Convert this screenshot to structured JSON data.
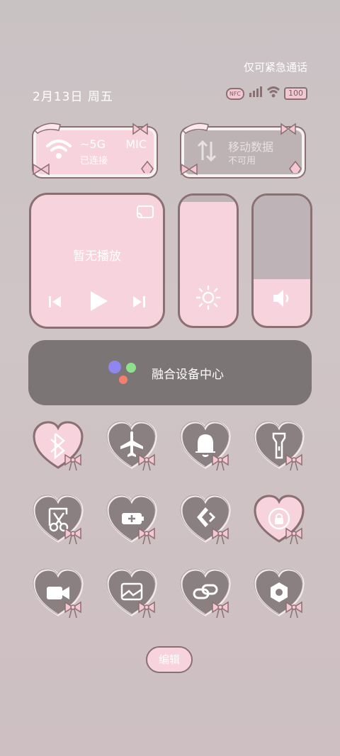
{
  "status": {
    "emergency_text": "仅可紧急通话",
    "date_text": "2月13日 周五",
    "battery": "100",
    "nfc": "NFC"
  },
  "tiles": {
    "wifi": {
      "title": "~5G",
      "subtitle": "已连接",
      "trailing": "MIC",
      "active": true
    },
    "mobile": {
      "title": "移动数据",
      "subtitle": "不可用",
      "active": false
    }
  },
  "media": {
    "label": "暂无播放"
  },
  "brightness": {
    "level": 0.95
  },
  "volume": {
    "level": 0.36
  },
  "fusion": {
    "label": "融合设备中心"
  },
  "toggles": [
    {
      "name": "bluetooth",
      "active": true
    },
    {
      "name": "airplane",
      "active": false
    },
    {
      "name": "bell",
      "active": false
    },
    {
      "name": "flashlight",
      "active": false
    },
    {
      "name": "screenshot",
      "active": false
    },
    {
      "name": "battery-saver",
      "active": false
    },
    {
      "name": "cast",
      "active": false
    },
    {
      "name": "rotation-lock",
      "active": true
    },
    {
      "name": "screen-record",
      "active": false
    },
    {
      "name": "screen-share",
      "active": false
    },
    {
      "name": "link",
      "active": false
    },
    {
      "name": "settings",
      "active": false
    }
  ],
  "edit": {
    "label": "编辑"
  },
  "colors": {
    "pink": "#f7d3de",
    "grey_tile": "#beb3b6",
    "outline": "#8a6f73",
    "fusion_bg": "#7c7576"
  }
}
